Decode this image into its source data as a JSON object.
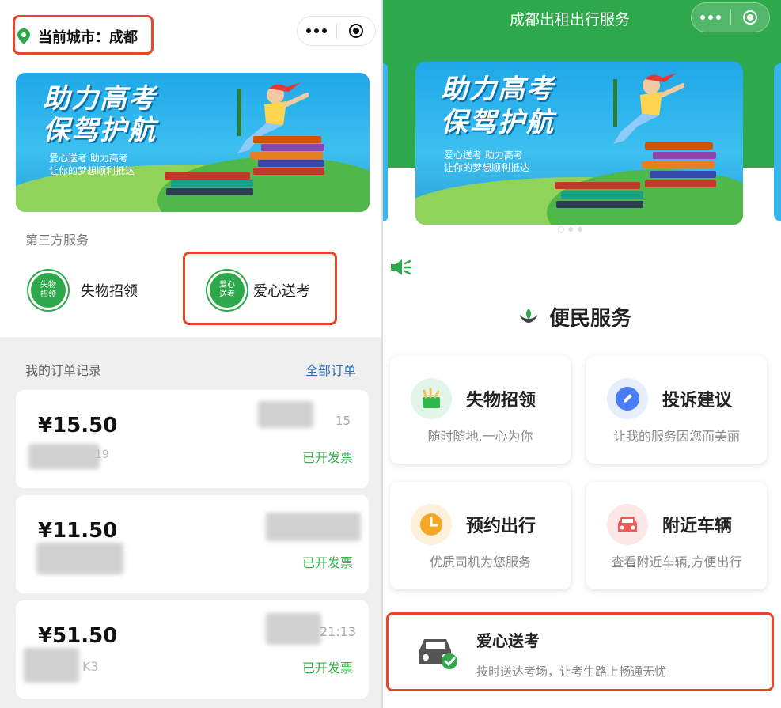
{
  "left": {
    "city_label": "当前城市：成都",
    "section_third_party": "第三方服务",
    "services": [
      {
        "badge": "失物招领",
        "label": "失物招领"
      },
      {
        "badge": "爱心送考",
        "label": "爱心送考"
      }
    ],
    "orders_title": "我的订单记录",
    "all_orders_link": "全部订单",
    "orders": [
      {
        "price": "¥15.50",
        "time_fragment": "15",
        "code_fragment": "19",
        "status": "已开发票"
      },
      {
        "price": "¥11.50",
        "time_fragment": "",
        "code_fragment": "",
        "status": "已开发票"
      },
      {
        "price": "¥51.50",
        "time_fragment": "21:13",
        "code_fragment": "K3",
        "status": "已开发票"
      }
    ]
  },
  "banner": {
    "title_line1": "助力高考",
    "title_line2": "保驾护航",
    "subtitle_line1": "爱心送考 助力高考",
    "subtitle_line2": "让你的梦想顺利抵达"
  },
  "right": {
    "header_title": "成都出租出行服务",
    "section_title": "便民服务",
    "services": [
      {
        "title": "失物招领",
        "desc": "随时随地,一心为你",
        "icon": "lost-found-icon",
        "color": "#2db74d"
      },
      {
        "title": "投诉建议",
        "desc": "让我的服务因您而美丽",
        "icon": "pencil-icon",
        "color": "#4a7cf6"
      },
      {
        "title": "预约出行",
        "desc": "优质司机为您服务",
        "icon": "clock-icon",
        "color": "#f5a623"
      },
      {
        "title": "附近车辆",
        "desc": "查看附近车辆,方便出行",
        "icon": "car-icon",
        "color": "#f15a5a"
      }
    ],
    "highlight": {
      "title": "爱心送考",
      "desc": "按时送达考场，让考生路上畅通无忧"
    }
  },
  "colors": {
    "brand_green": "#2da84a",
    "highlight_red": "#e8462a",
    "invoice_green": "#37b24d",
    "link_blue": "#2f6db5"
  }
}
